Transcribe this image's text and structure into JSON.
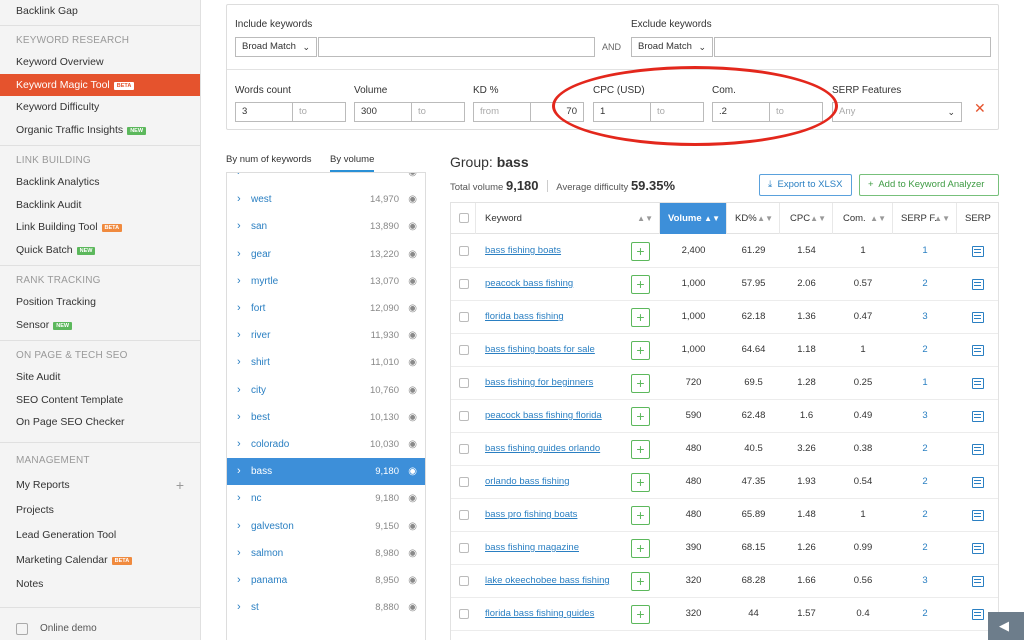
{
  "sidebar": {
    "top_item": "Backlink Gap",
    "keyword_research": {
      "title": "KEYWORD RESEARCH",
      "items": [
        {
          "label": "Keyword Overview"
        },
        {
          "label": "Keyword Magic Tool",
          "badge": "BETA"
        },
        {
          "label": "Keyword Difficulty"
        },
        {
          "label": "Organic Traffic Insights",
          "badge": "NEW"
        }
      ]
    },
    "link_building": {
      "title": "LINK BUILDING",
      "items": [
        {
          "label": "Backlink Analytics"
        },
        {
          "label": "Backlink Audit"
        },
        {
          "label": "Link Building Tool",
          "badge": "BETA"
        },
        {
          "label": "Quick Batch",
          "badge": "NEW"
        }
      ]
    },
    "rank_tracking": {
      "title": "RANK TRACKING",
      "items": [
        {
          "label": "Position Tracking"
        },
        {
          "label": "Sensor",
          "badge": "NEW"
        }
      ]
    },
    "on_page": {
      "title": "ON PAGE & TECH SEO",
      "items": [
        {
          "label": "Site Audit"
        },
        {
          "label": "SEO Content Template"
        },
        {
          "label": "On Page SEO Checker"
        }
      ]
    },
    "management": {
      "title": "MANAGEMENT",
      "items": [
        {
          "label": "My Reports"
        },
        {
          "label": "Projects"
        },
        {
          "label": "Lead Generation Tool"
        },
        {
          "label": "Marketing Calendar",
          "badge": "BETA"
        },
        {
          "label": "Notes"
        }
      ]
    },
    "online_demo": "Online demo"
  },
  "filters": {
    "include": {
      "label": "Include keywords",
      "match": "Broad Match",
      "value": ""
    },
    "and_label": "AND",
    "exclude": {
      "label": "Exclude keywords",
      "match": "Broad Match",
      "value": ""
    },
    "words_count": {
      "label": "Words count",
      "from": "3",
      "to": "to"
    },
    "volume": {
      "label": "Volume",
      "from": "300",
      "to": "to"
    },
    "kd": {
      "label": "KD %",
      "from": "from",
      "to": "70"
    },
    "cpc": {
      "label": "CPC (USD)",
      "from": "1",
      "to": "to"
    },
    "com": {
      "label": "Com.",
      "from": ".2",
      "to": "to"
    },
    "serp": {
      "label": "SERP Features",
      "value": "Any"
    }
  },
  "group_tabs": {
    "by_num": "By num of keywords",
    "by_volume": "By volume"
  },
  "groups": [
    {
      "name": "",
      "volume": ""
    },
    {
      "name": "west",
      "volume": "14,970"
    },
    {
      "name": "san",
      "volume": "13,890"
    },
    {
      "name": "gear",
      "volume": "13,220"
    },
    {
      "name": "myrtle",
      "volume": "13,070"
    },
    {
      "name": "fort",
      "volume": "12,090"
    },
    {
      "name": "river",
      "volume": "11,930"
    },
    {
      "name": "shirt",
      "volume": "11,010"
    },
    {
      "name": "city",
      "volume": "10,760"
    },
    {
      "name": "best",
      "volume": "10,130"
    },
    {
      "name": "colorado",
      "volume": "10,030"
    },
    {
      "name": "bass",
      "volume": "9,180",
      "active": true
    },
    {
      "name": "nc",
      "volume": "9,180"
    },
    {
      "name": "galveston",
      "volume": "9,150"
    },
    {
      "name": "salmon",
      "volume": "8,980"
    },
    {
      "name": "panama",
      "volume": "8,950"
    },
    {
      "name": "st",
      "volume": "8,880"
    }
  ],
  "group": {
    "title_prefix": "Group:",
    "name": "bass",
    "total_volume_label": "Total volume",
    "total_volume": "9,180",
    "avg_difficulty_label": "Average difficulty",
    "avg_difficulty": "59.35%",
    "export_label": "Export to XLSX",
    "add_label": "Add to Keyword Analyzer"
  },
  "table": {
    "columns": {
      "keyword": "Keyword",
      "volume": "Volume",
      "kd": "KD%",
      "cpc": "CPC",
      "com": "Com.",
      "serpf": "SERP F.",
      "serp": "SERP"
    },
    "rows": [
      {
        "keyword": "bass fishing boats",
        "volume": "2,400",
        "kd": "61.29",
        "cpc": "1.54",
        "com": "1",
        "serpf": "1"
      },
      {
        "keyword": "peacock bass fishing",
        "volume": "1,000",
        "kd": "57.95",
        "cpc": "2.06",
        "com": "0.57",
        "serpf": "2"
      },
      {
        "keyword": "florida bass fishing",
        "volume": "1,000",
        "kd": "62.18",
        "cpc": "1.36",
        "com": "0.47",
        "serpf": "3"
      },
      {
        "keyword": "bass fishing boats for sale",
        "volume": "1,000",
        "kd": "64.64",
        "cpc": "1.18",
        "com": "1",
        "serpf": "2"
      },
      {
        "keyword": "bass fishing for beginners",
        "volume": "720",
        "kd": "69.5",
        "cpc": "1.28",
        "com": "0.25",
        "serpf": "1"
      },
      {
        "keyword": "peacock bass fishing florida",
        "volume": "590",
        "kd": "62.48",
        "cpc": "1.6",
        "com": "0.49",
        "serpf": "3"
      },
      {
        "keyword": "bass fishing guides orlando",
        "volume": "480",
        "kd": "40.5",
        "cpc": "3.26",
        "com": "0.38",
        "serpf": "2"
      },
      {
        "keyword": "orlando bass fishing",
        "volume": "480",
        "kd": "47.35",
        "cpc": "1.93",
        "com": "0.54",
        "serpf": "2"
      },
      {
        "keyword": "bass pro fishing boats",
        "volume": "480",
        "kd": "65.89",
        "cpc": "1.48",
        "com": "1",
        "serpf": "2"
      },
      {
        "keyword": "bass fishing magazine",
        "volume": "390",
        "kd": "68.15",
        "cpc": "1.26",
        "com": "0.99",
        "serpf": "2"
      },
      {
        "keyword": "lake okeechobee bass fishing",
        "volume": "320",
        "kd": "68.28",
        "cpc": "1.66",
        "com": "0.56",
        "serpf": "3"
      },
      {
        "keyword": "florida bass fishing guides",
        "volume": "320",
        "kd": "44",
        "cpc": "1.57",
        "com": "0.4",
        "serpf": "2"
      }
    ]
  },
  "colors": {
    "accent": "#e5532d",
    "link": "#2a7fc2",
    "selected": "#3d8fd9",
    "add": "#5cb85c",
    "highlight_oval": "#e3271c"
  }
}
